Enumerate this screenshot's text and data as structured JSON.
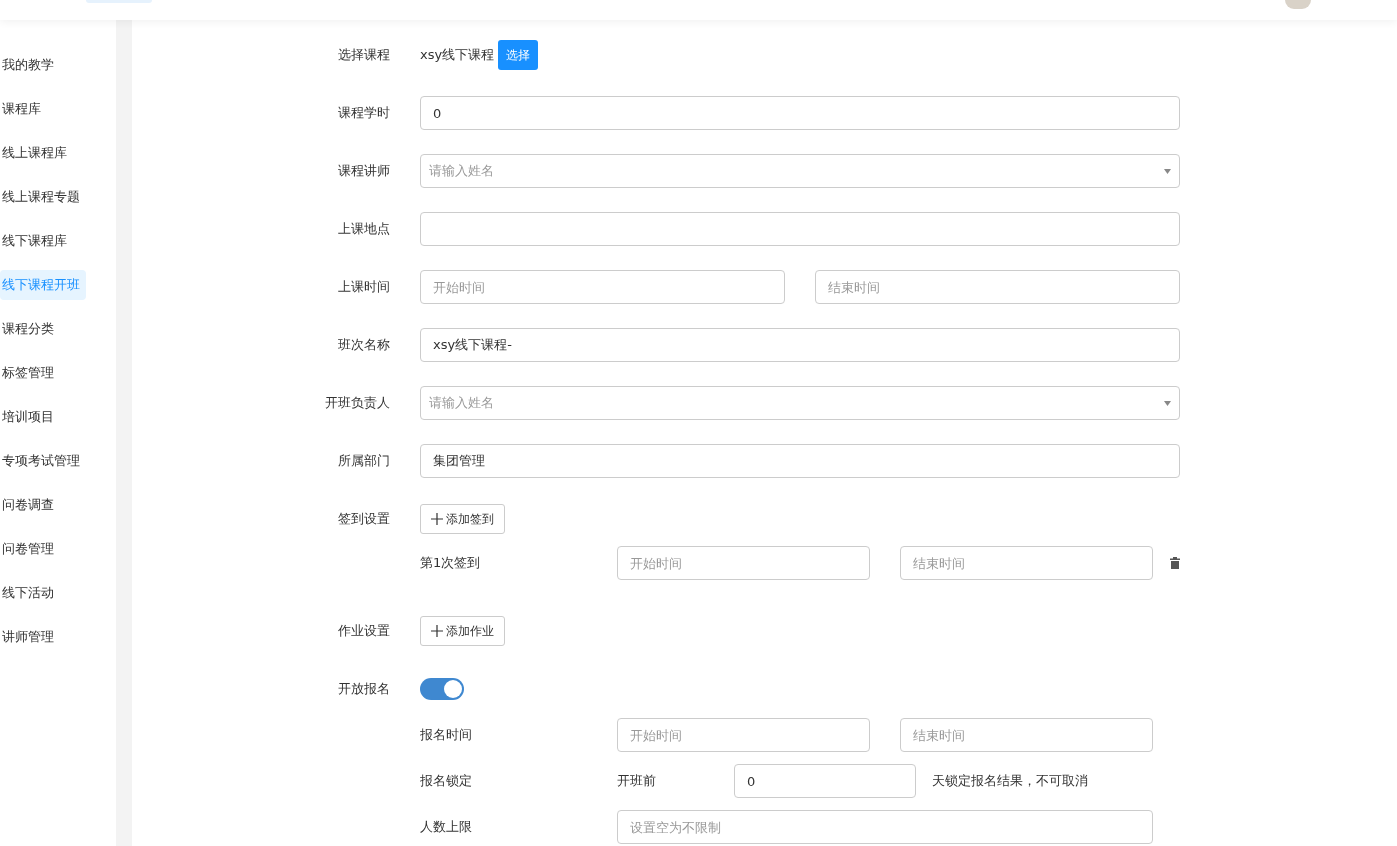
{
  "sidebar": {
    "items": [
      {
        "label": "我的教学",
        "selected": false
      },
      {
        "label": "课程库",
        "selected": false
      },
      {
        "label": "线上课程库",
        "selected": false
      },
      {
        "label": "线上课程专题",
        "selected": false
      },
      {
        "label": "线下课程库",
        "selected": false
      },
      {
        "label": "线下课程开班",
        "selected": true
      },
      {
        "label": "课程分类",
        "selected": false
      },
      {
        "label": "标签管理",
        "selected": false
      },
      {
        "label": "培训项目",
        "selected": false
      },
      {
        "label": "专项考试管理",
        "selected": false
      },
      {
        "label": "问卷调查",
        "selected": false
      },
      {
        "label": "问卷管理",
        "selected": false
      },
      {
        "label": "线下活动",
        "selected": false
      },
      {
        "label": "讲师管理",
        "selected": false
      }
    ]
  },
  "form": {
    "rows": [
      {
        "kind": "course",
        "label": "选择课程",
        "value": "xsy线下课程",
        "button": "选择"
      },
      {
        "kind": "input",
        "label": "课程学时",
        "value": "0"
      },
      {
        "kind": "select",
        "label": "课程讲师",
        "placeholder": "请输入姓名"
      },
      {
        "kind": "input",
        "label": "上课地点"
      },
      {
        "kind": "range",
        "label": "上课时间",
        "start_placeholder": "开始时间",
        "end_placeholder": "结束时间"
      },
      {
        "kind": "input",
        "label": "班次名称",
        "value": "xsy线下课程-"
      },
      {
        "kind": "select",
        "label": "开班负责人",
        "placeholder": "请输入姓名"
      },
      {
        "kind": "input",
        "label": "所属部门",
        "value": "集团管理"
      },
      {
        "kind": "add",
        "label": "签到设置",
        "button": "添加签到",
        "items": [
          {
            "label": "第1次签到",
            "start_placeholder": "开始时间",
            "end_placeholder": "结束时间"
          }
        ]
      },
      {
        "kind": "add",
        "label": "作业设置",
        "button": "添加作业"
      },
      {
        "kind": "toggle",
        "label": "开放报名",
        "on": true,
        "sub_rows": [
          {
            "kind": "range",
            "label": "报名时间",
            "start_placeholder": "开始时间",
            "end_placeholder": "结束时间"
          },
          {
            "kind": "lock",
            "label": "报名锁定",
            "prefix": "开班前",
            "value": "0",
            "suffix": "天锁定报名结果，不可取消"
          },
          {
            "kind": "input",
            "label": "人数上限",
            "placeholder": "设置空为不限制"
          }
        ]
      }
    ]
  }
}
